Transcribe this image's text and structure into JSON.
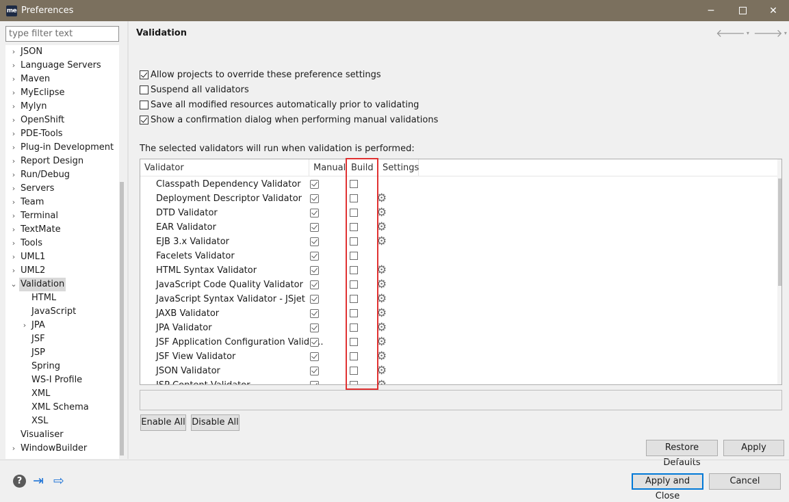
{
  "window": {
    "icon_text": "me",
    "title": "Preferences",
    "minimize": "─",
    "close": "✕"
  },
  "filter": {
    "placeholder": "type filter text"
  },
  "tree": [
    {
      "label": "JSON",
      "expander": "›",
      "level": 0
    },
    {
      "label": "Language Servers",
      "expander": "›",
      "level": 0
    },
    {
      "label": "Maven",
      "expander": "›",
      "level": 0
    },
    {
      "label": "MyEclipse",
      "expander": "›",
      "level": 0
    },
    {
      "label": "Mylyn",
      "expander": "›",
      "level": 0
    },
    {
      "label": "OpenShift",
      "expander": "›",
      "level": 0
    },
    {
      "label": "PDE-Tools",
      "expander": "›",
      "level": 0
    },
    {
      "label": "Plug-in Development",
      "expander": "›",
      "level": 0
    },
    {
      "label": "Report Design",
      "expander": "›",
      "level": 0
    },
    {
      "label": "Run/Debug",
      "expander": "›",
      "level": 0
    },
    {
      "label": "Servers",
      "expander": "›",
      "level": 0
    },
    {
      "label": "Team",
      "expander": "›",
      "level": 0
    },
    {
      "label": "Terminal",
      "expander": "›",
      "level": 0
    },
    {
      "label": "TextMate",
      "expander": "›",
      "level": 0
    },
    {
      "label": "Tools",
      "expander": "›",
      "level": 0
    },
    {
      "label": "UML1",
      "expander": "›",
      "level": 0
    },
    {
      "label": "UML2",
      "expander": "›",
      "level": 0
    },
    {
      "label": "Validation",
      "expander": "⌄",
      "level": 0,
      "selected": true
    },
    {
      "label": "HTML",
      "expander": "",
      "level": 1
    },
    {
      "label": "JavaScript",
      "expander": "",
      "level": 1
    },
    {
      "label": "JPA",
      "expander": "›",
      "level": 1
    },
    {
      "label": "JSF",
      "expander": "",
      "level": 1
    },
    {
      "label": "JSP",
      "expander": "",
      "level": 1
    },
    {
      "label": "Spring",
      "expander": "",
      "level": 1
    },
    {
      "label": "WS-I Profile",
      "expander": "",
      "level": 1
    },
    {
      "label": "XML",
      "expander": "",
      "level": 1
    },
    {
      "label": "XML Schema",
      "expander": "",
      "level": 1
    },
    {
      "label": "XSL",
      "expander": "",
      "level": 1
    },
    {
      "label": "Visualiser",
      "expander": "",
      "level": 0
    },
    {
      "label": "WindowBuilder",
      "expander": "›",
      "level": 0
    }
  ],
  "page": {
    "title": "Validation",
    "nav": {
      "back": "🡐",
      "forward": "🡒",
      "dropdown": "▾",
      "menu": "▼"
    }
  },
  "options": [
    {
      "label": "Allow projects to override these preference settings",
      "checked": true
    },
    {
      "label": "Suspend all validators",
      "checked": false
    },
    {
      "label": "Save all modified resources automatically prior to validating",
      "checked": false
    },
    {
      "label": "Show a confirmation dialog when performing manual validations",
      "checked": true
    }
  ],
  "info_text": "The selected validators will run when validation is performed:",
  "table": {
    "headers": [
      "Validator",
      "Manual",
      "Build",
      "Settings"
    ],
    "rows": [
      {
        "name": "Classpath Dependency Validator",
        "manual": true,
        "build": false,
        "settings": false
      },
      {
        "name": "Deployment Descriptor Validator",
        "manual": true,
        "build": false,
        "settings": true
      },
      {
        "name": "DTD Validator",
        "manual": true,
        "build": false,
        "settings": true
      },
      {
        "name": "EAR Validator",
        "manual": true,
        "build": false,
        "settings": true
      },
      {
        "name": "EJB 3.x Validator",
        "manual": true,
        "build": false,
        "settings": true
      },
      {
        "name": "Facelets Validator",
        "manual": true,
        "build": false,
        "settings": false
      },
      {
        "name": "HTML Syntax Validator",
        "manual": true,
        "build": false,
        "settings": true
      },
      {
        "name": "JavaScript Code Quality Validator",
        "manual": true,
        "build": false,
        "settings": true
      },
      {
        "name": "JavaScript Syntax Validator - JSjet",
        "manual": true,
        "build": false,
        "settings": true
      },
      {
        "name": "JAXB Validator",
        "manual": true,
        "build": false,
        "settings": true
      },
      {
        "name": "JPA Validator",
        "manual": true,
        "build": false,
        "settings": true
      },
      {
        "name": "JSF Application Configuration Valida...",
        "manual": true,
        "build": false,
        "settings": true
      },
      {
        "name": "JSF View Validator",
        "manual": true,
        "build": false,
        "settings": true
      },
      {
        "name": "JSON Validator",
        "manual": true,
        "build": false,
        "settings": true
      },
      {
        "name": "JSP Content Validator",
        "manual": true,
        "build": false,
        "settings": true
      }
    ],
    "gear_glyph": "⚙"
  },
  "buttons": {
    "enable_all": "Enable All",
    "disable_all": "Disable All",
    "restore_defaults": "Restore Defaults",
    "apply": "Apply",
    "apply_and_close": "Apply and Close",
    "cancel": "Cancel"
  },
  "bottom_icons": {
    "help": "?",
    "import": "⇥",
    "export": "⇨"
  },
  "colors": {
    "titlebar": "#7b705e",
    "highlight": "#e03030",
    "accent": "#1e73d6"
  }
}
